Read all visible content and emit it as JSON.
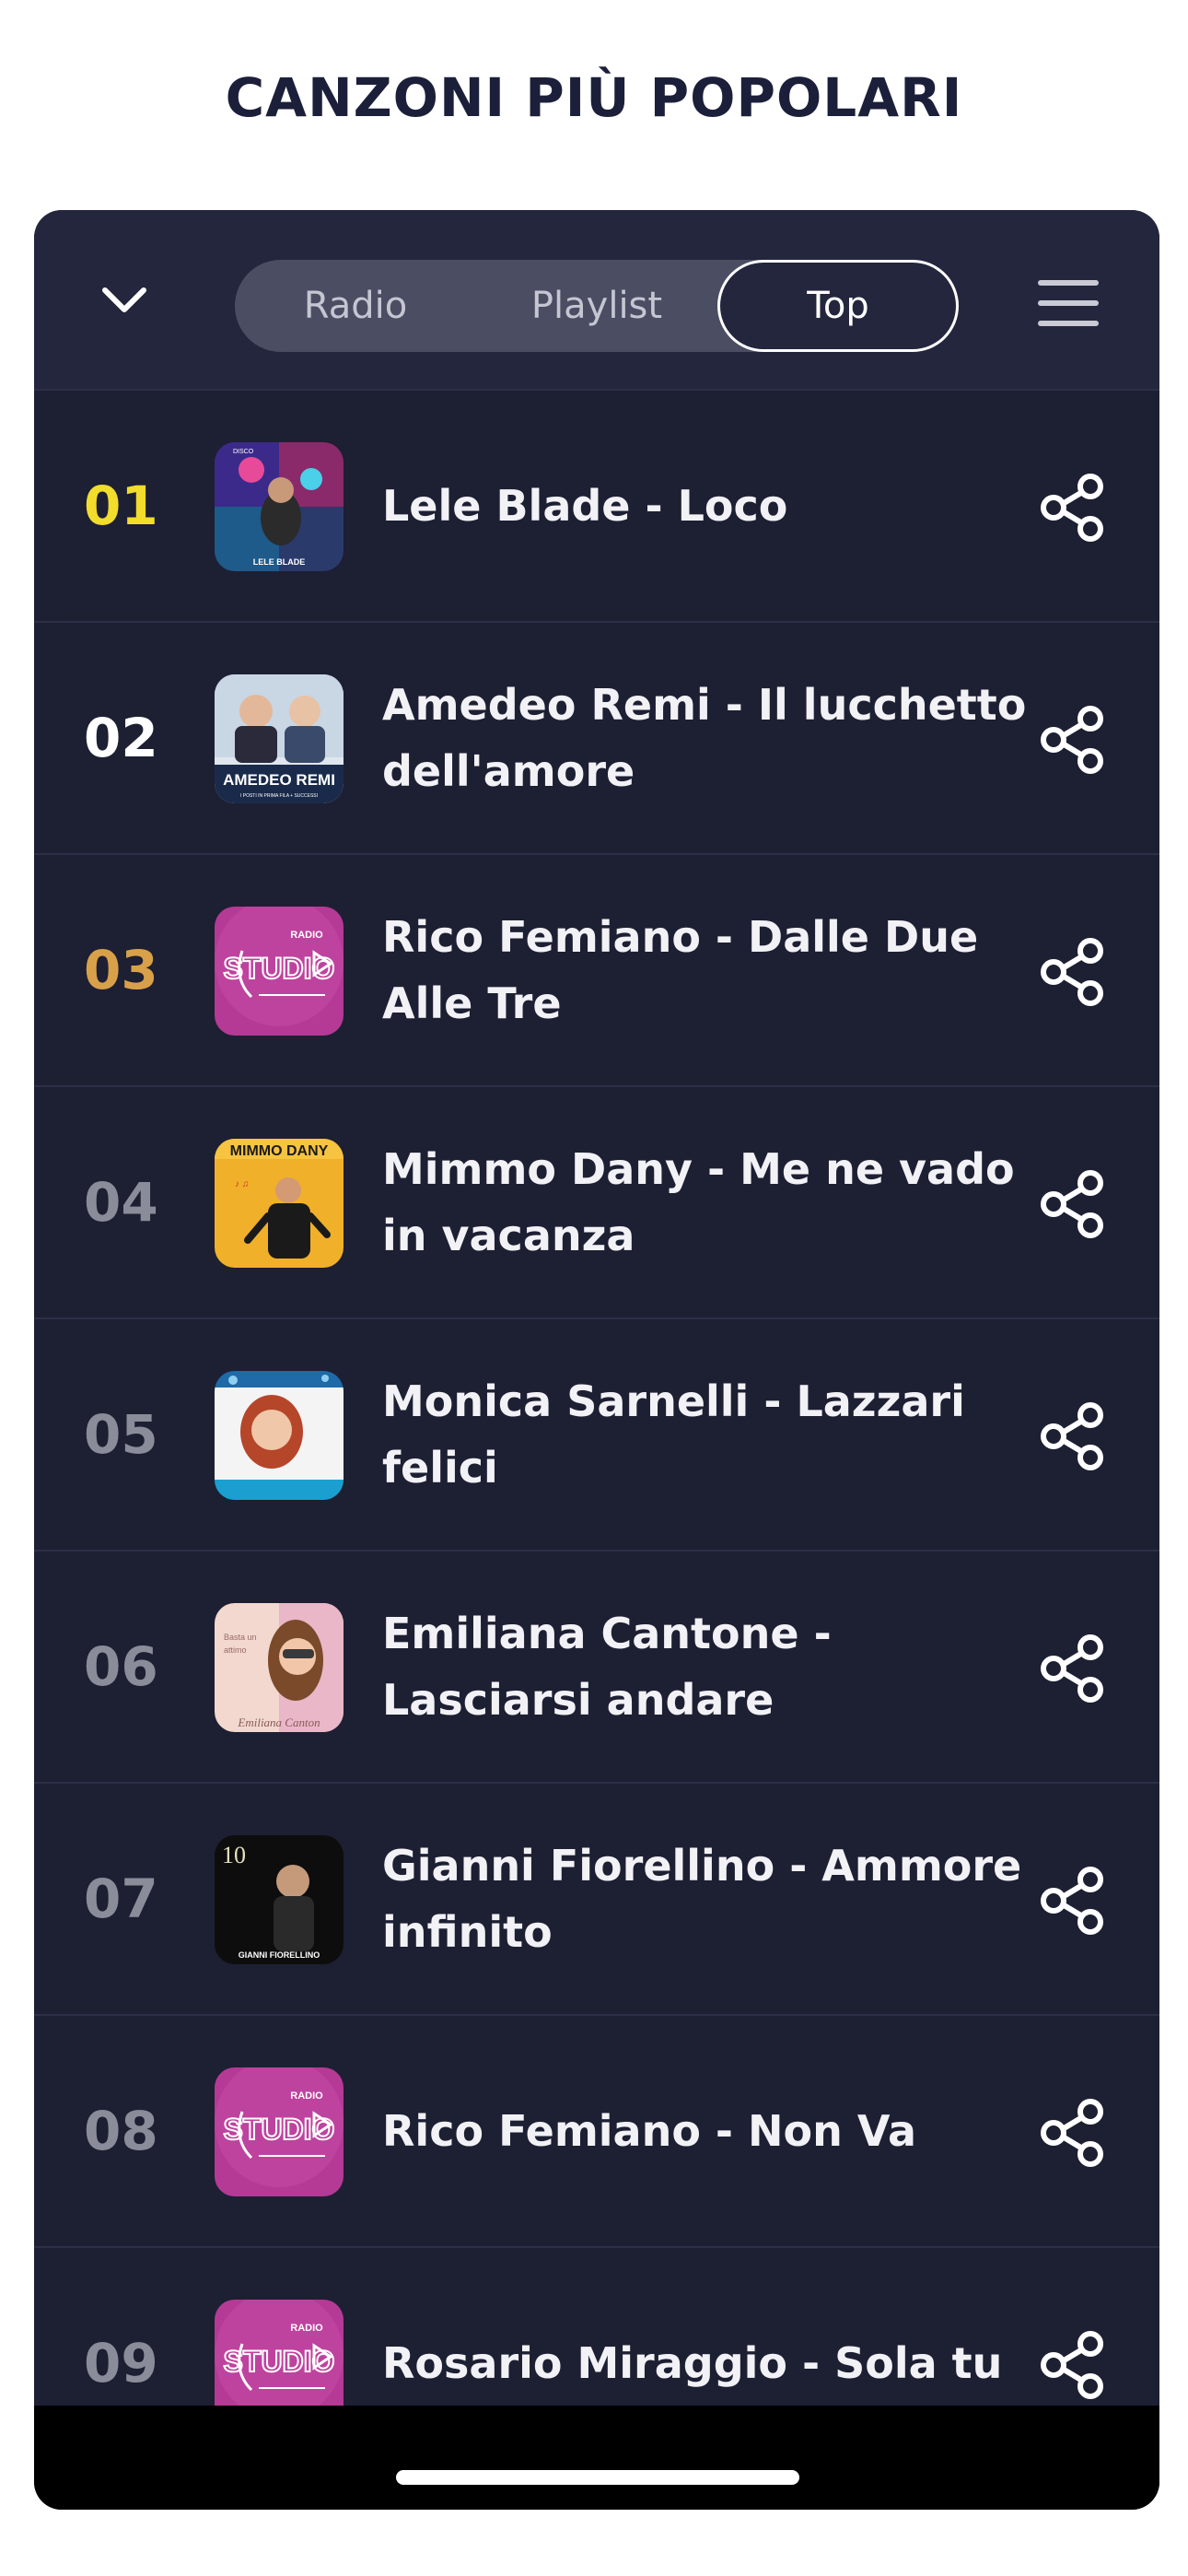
{
  "page": {
    "title": "CANZONI PIÙ POPOLARI"
  },
  "header": {
    "collapse_icon": "chevron-down-icon",
    "menu_icon": "hamburger-menu-icon",
    "tabs": [
      {
        "label": "Radio",
        "active": false
      },
      {
        "label": "Playlist",
        "active": false
      },
      {
        "label": "Top",
        "active": true
      }
    ]
  },
  "colors": {
    "rank_1": "#f2dc2c",
    "rank_2": "#ffffff",
    "rank_3": "#d9a04a",
    "rank_other": "#8a8c99"
  },
  "songs": [
    {
      "rank": "01",
      "title": "Lele Blade - Loco",
      "cover": "lele-blade-cover"
    },
    {
      "rank": "02",
      "title": "Amedeo Remi - Il lucchetto dell'amore",
      "cover": "amedeo-remi-cover"
    },
    {
      "rank": "03",
      "title": "Rico Femiano - Dalle Due Alle Tre",
      "cover": "radio-studio-cover"
    },
    {
      "rank": "04",
      "title": "Mimmo Dany - Me ne vado in vacanza",
      "cover": "mimmo-dany-cover"
    },
    {
      "rank": "05",
      "title": "Monica Sarnelli - Lazzari felici",
      "cover": "monica-sarnelli-cover"
    },
    {
      "rank": "06",
      "title": "Emiliana Cantone - Lasciarsi andare",
      "cover": "emiliana-cantone-cover"
    },
    {
      "rank": "07",
      "title": "Gianni Fiorellino - Ammore infinito",
      "cover": "gianni-fiorellino-cover"
    },
    {
      "rank": "08",
      "title": "Rico Femiano - Non Va",
      "cover": "radio-studio-cover"
    },
    {
      "rank": "09",
      "title": "Rosario Miraggio - Sola tu",
      "cover": "radio-studio-cover"
    }
  ],
  "covers": {
    "lele": {
      "small_text": "LELE BLADE",
      "top_text": "DISCO"
    },
    "amedeo": {
      "name": "AMEDEO REMI",
      "sub": "I POSTI IN PRIMA FILA + SUCCESSI"
    },
    "mimmo": {
      "name": "MIMMO DANY"
    },
    "emiliana": {
      "text": "Emiliana Canton"
    },
    "gianni": {
      "number": "10",
      "name": "GIANNI FIORELLINO"
    },
    "studio": {
      "radio": "RADIO",
      "studio": "STUDIO"
    }
  }
}
